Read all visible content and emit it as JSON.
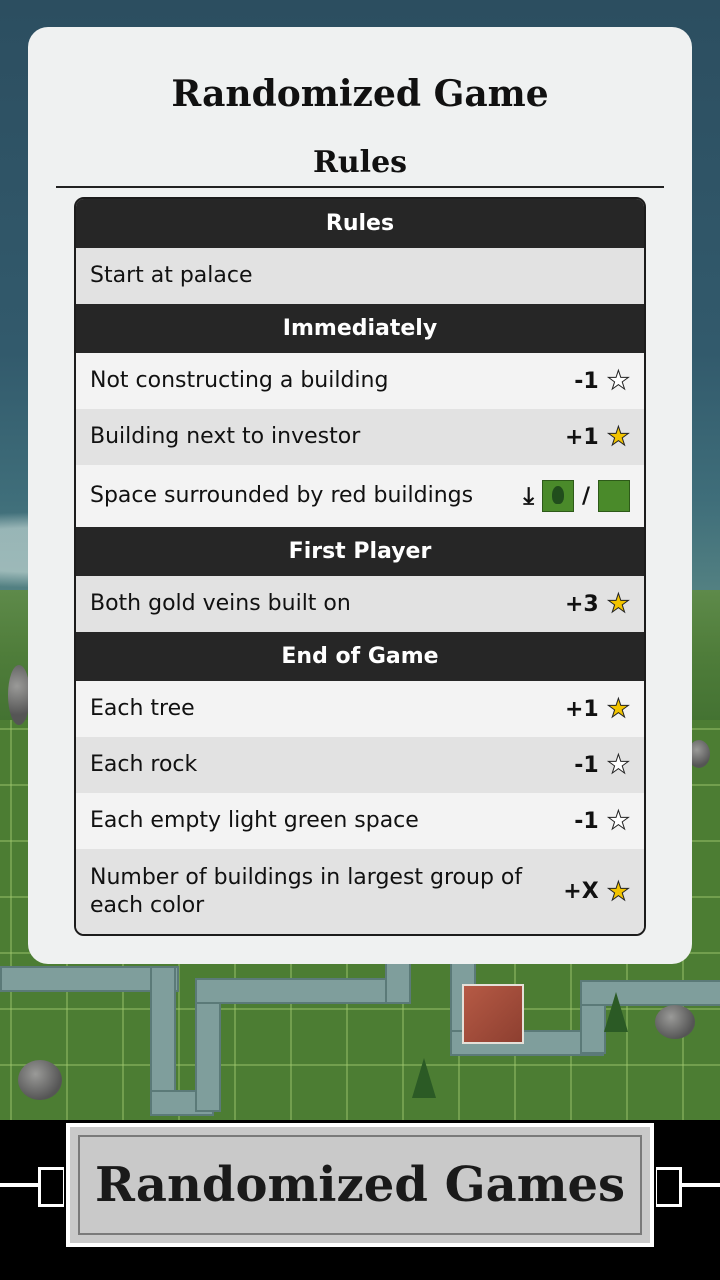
{
  "dialog": {
    "title": "Randomized Game",
    "subtitle": "Rules"
  },
  "rules_table": {
    "sections": [
      {
        "header": "Rules",
        "rows": [
          {
            "text": "Start at palace"
          }
        ]
      },
      {
        "header": "Immediately",
        "rows": [
          {
            "text": "Not constructing a building",
            "value": "-1",
            "star": "outline"
          },
          {
            "text": "Building next to investor",
            "value": "+1",
            "star": "filled"
          },
          {
            "text": "Space surrounded by red buildings",
            "icons": [
              "download-icon",
              "tree-tile-icon",
              "/",
              "green-tile-icon"
            ]
          }
        ]
      },
      {
        "header": "First Player",
        "rows": [
          {
            "text": "Both gold veins built on",
            "value": "+3",
            "star": "filled"
          }
        ]
      },
      {
        "header": "End of Game",
        "rows": [
          {
            "text": "Each tree",
            "value": "+1",
            "star": "filled"
          },
          {
            "text": "Each rock",
            "value": "-1",
            "star": "outline"
          },
          {
            "text": "Each empty light green space",
            "value": "-1",
            "star": "outline"
          },
          {
            "text": "Number of buildings in largest group of each color",
            "value": "+X",
            "star": "filled"
          }
        ]
      }
    ],
    "slash_separator": "/"
  },
  "bottom_banner": {
    "label": "Randomized Games"
  },
  "colors": {
    "header_bg": "#262626",
    "star_filled": "#f2c400",
    "card_bg": "#eff1f1"
  }
}
